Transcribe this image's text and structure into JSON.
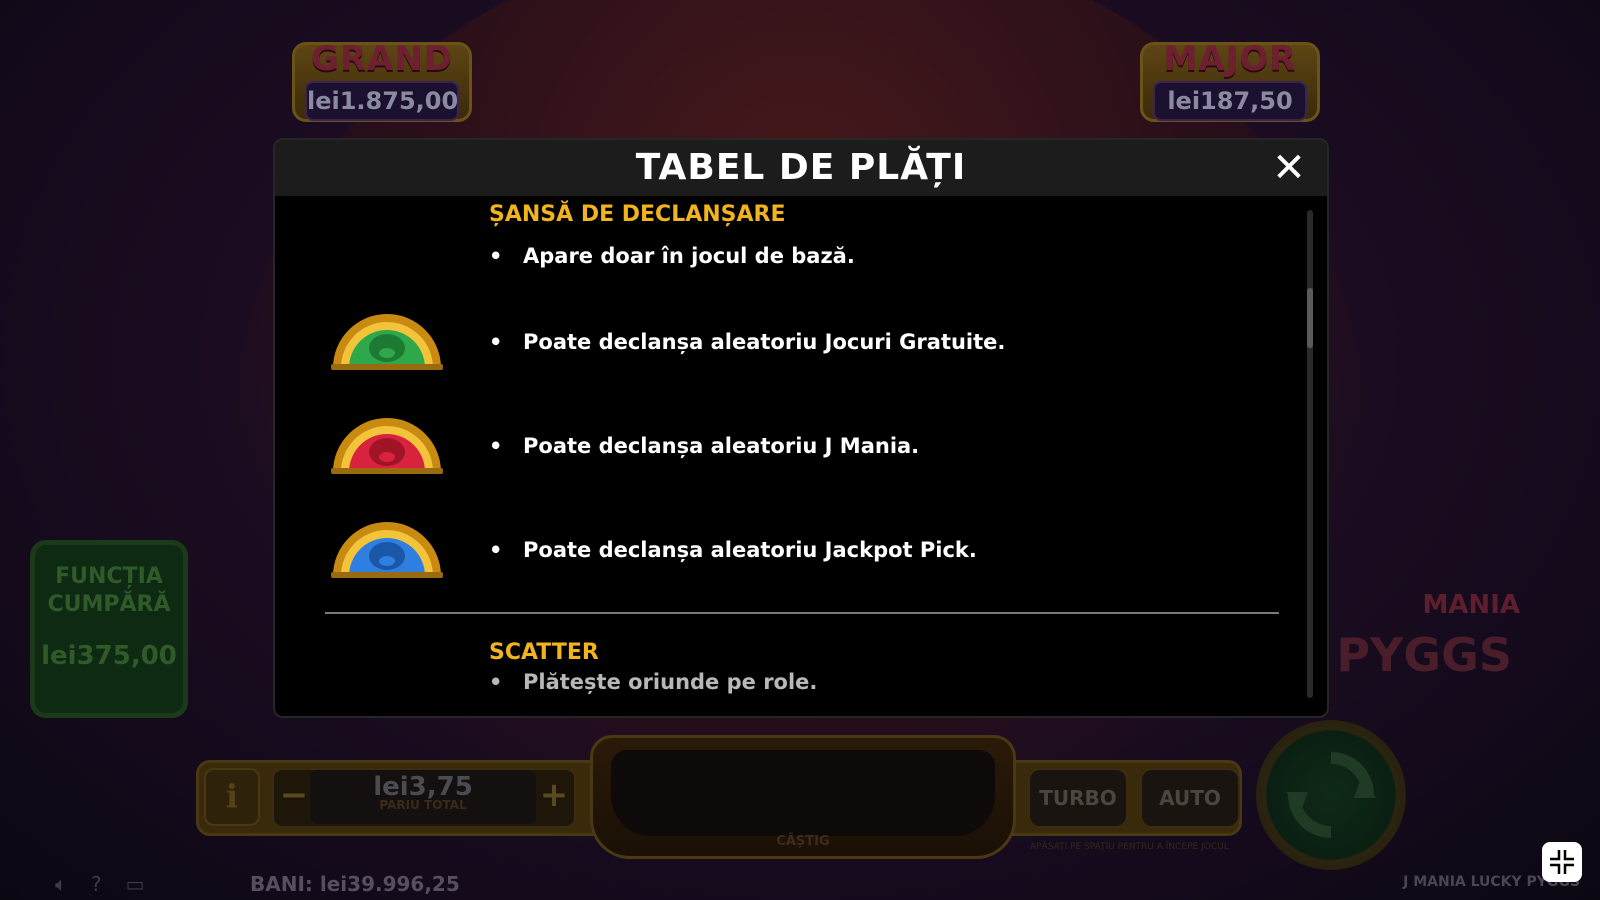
{
  "background": {
    "jackpots": [
      {
        "title": "GRAND",
        "value": "lei1.875,00"
      },
      {
        "title": "MAJOR",
        "value": "lei187,50"
      }
    ],
    "buy_feature": {
      "label_line1": "FUNCȚIA",
      "label_line2": "CUMPĂRĂ",
      "price": "lei375,00"
    },
    "logo_line1": "MANIA",
    "logo_line2": "Y PYGGS"
  },
  "controls": {
    "info_icon": "i",
    "minus": "−",
    "plus": "+",
    "bet_value": "lei3,75",
    "bet_label": "PARIU TOTAL",
    "win_label": "CÂȘTIG",
    "turbo": "TURBO",
    "auto": "AUTO",
    "hint": "APĂSAȚI PE SPAȚIU PENTRU A ÎNCEPE JOCUL"
  },
  "footer": {
    "balance_label": "BANI:",
    "balance_value": "lei39.996,25",
    "game_title": "J MANIA LUCKY PYGGS",
    "help_glyph": "?"
  },
  "modal": {
    "title": "TABEL DE PLĂȚI",
    "close_glyph": "✕",
    "section1_heading": "ȘANSĂ DE DECLANȘARE",
    "section1_bullets": [
      "Apare doar în jocul de bază.",
      "Poate declanșa aleatoriu Jocuri Gratuite.",
      "Poate declanșa aleatoriu J Mania.",
      "Poate declanșa aleatoriu Jackpot Pick."
    ],
    "symbols": [
      {
        "name": "green-pig-coin",
        "color": "#2ea84a"
      },
      {
        "name": "red-pig-coin",
        "color": "#d8223e"
      },
      {
        "name": "blue-pig-coin",
        "color": "#2f7fe0"
      }
    ],
    "section2_heading": "SCATTER",
    "section2_bullets": [
      "Plătește oriunde pe role."
    ],
    "bullet_glyph": "•"
  },
  "colors": {
    "accent_gold": "#f1b41e",
    "modal_header": "#1c1c1c"
  }
}
